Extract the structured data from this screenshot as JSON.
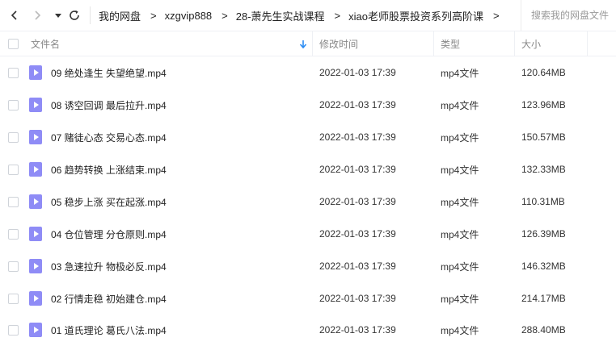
{
  "breadcrumb": [
    {
      "label": "我的网盘"
    },
    {
      "label": "xzgvip888"
    },
    {
      "label": "28-萧先生实战课程"
    },
    {
      "label": "xiao老师股票投资系列高阶课"
    }
  ],
  "search": {
    "placeholder": "搜索我的网盘文件"
  },
  "columns": {
    "name": "文件名",
    "modified": "修改时间",
    "type": "类型",
    "size": "大小"
  },
  "icons": {
    "back": "chevron-left-icon",
    "forward": "chevron-right-icon",
    "history": "caret-down-icon",
    "refresh": "refresh-icon",
    "sort": "sort-down-arrow-icon",
    "file": "video-file-icon"
  },
  "colors": {
    "file_icon": "#8f8cf6",
    "sort_arrow": "#2b8cf3"
  },
  "files": [
    {
      "name": "09 绝处逢生 失望绝望.mp4",
      "modified": "2022-01-03 17:39",
      "type": "mp4文件",
      "size": "120.64MB"
    },
    {
      "name": "08 诱空回调 最后拉升.mp4",
      "modified": "2022-01-03 17:39",
      "type": "mp4文件",
      "size": "123.96MB"
    },
    {
      "name": "07 赌徒心态 交易心态.mp4",
      "modified": "2022-01-03 17:39",
      "type": "mp4文件",
      "size": "150.57MB"
    },
    {
      "name": "06 趋势转换 上涨结束.mp4",
      "modified": "2022-01-03 17:39",
      "type": "mp4文件",
      "size": "132.33MB"
    },
    {
      "name": "05 稳步上涨 买在起涨.mp4",
      "modified": "2022-01-03 17:39",
      "type": "mp4文件",
      "size": "110.31MB"
    },
    {
      "name": "04 仓位管理 分仓原则.mp4",
      "modified": "2022-01-03 17:39",
      "type": "mp4文件",
      "size": "126.39MB"
    },
    {
      "name": "03 急速拉升 物极必反.mp4",
      "modified": "2022-01-03 17:39",
      "type": "mp4文件",
      "size": "146.32MB"
    },
    {
      "name": "02 行情走稳 初始建仓.mp4",
      "modified": "2022-01-03 17:39",
      "type": "mp4文件",
      "size": "214.17MB"
    },
    {
      "name": "01 道氏理论 葛氏八法.mp4",
      "modified": "2022-01-03 17:39",
      "type": "mp4文件",
      "size": "288.40MB"
    }
  ]
}
